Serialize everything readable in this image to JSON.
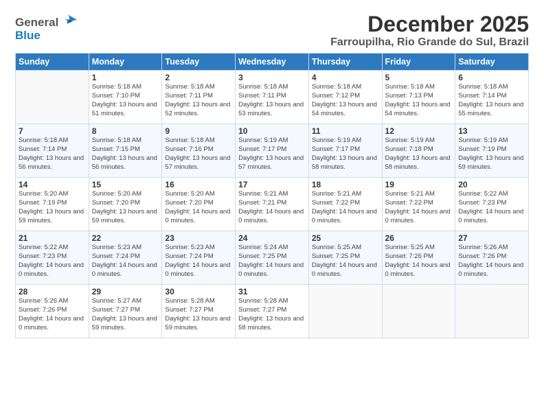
{
  "logo": {
    "general": "General",
    "blue": "Blue"
  },
  "title": {
    "month_year": "December 2025",
    "location": "Farroupilha, Rio Grande do Sul, Brazil"
  },
  "days_of_week": [
    "Sunday",
    "Monday",
    "Tuesday",
    "Wednesday",
    "Thursday",
    "Friday",
    "Saturday"
  ],
  "weeks": [
    [
      {
        "day": "",
        "sunrise": "",
        "sunset": "",
        "daylight": ""
      },
      {
        "day": "1",
        "sunrise": "Sunrise: 5:18 AM",
        "sunset": "Sunset: 7:10 PM",
        "daylight": "Daylight: 13 hours and 51 minutes."
      },
      {
        "day": "2",
        "sunrise": "Sunrise: 5:18 AM",
        "sunset": "Sunset: 7:11 PM",
        "daylight": "Daylight: 13 hours and 52 minutes."
      },
      {
        "day": "3",
        "sunrise": "Sunrise: 5:18 AM",
        "sunset": "Sunset: 7:11 PM",
        "daylight": "Daylight: 13 hours and 53 minutes."
      },
      {
        "day": "4",
        "sunrise": "Sunrise: 5:18 AM",
        "sunset": "Sunset: 7:12 PM",
        "daylight": "Daylight: 13 hours and 54 minutes."
      },
      {
        "day": "5",
        "sunrise": "Sunrise: 5:18 AM",
        "sunset": "Sunset: 7:13 PM",
        "daylight": "Daylight: 13 hours and 54 minutes."
      },
      {
        "day": "6",
        "sunrise": "Sunrise: 5:18 AM",
        "sunset": "Sunset: 7:14 PM",
        "daylight": "Daylight: 13 hours and 55 minutes."
      }
    ],
    [
      {
        "day": "7",
        "sunrise": "Sunrise: 5:18 AM",
        "sunset": "Sunset: 7:14 PM",
        "daylight": "Daylight: 13 hours and 56 minutes."
      },
      {
        "day": "8",
        "sunrise": "Sunrise: 5:18 AM",
        "sunset": "Sunset: 7:15 PM",
        "daylight": "Daylight: 13 hours and 56 minutes."
      },
      {
        "day": "9",
        "sunrise": "Sunrise: 5:18 AM",
        "sunset": "Sunset: 7:16 PM",
        "daylight": "Daylight: 13 hours and 57 minutes."
      },
      {
        "day": "10",
        "sunrise": "Sunrise: 5:19 AM",
        "sunset": "Sunset: 7:17 PM",
        "daylight": "Daylight: 13 hours and 57 minutes."
      },
      {
        "day": "11",
        "sunrise": "Sunrise: 5:19 AM",
        "sunset": "Sunset: 7:17 PM",
        "daylight": "Daylight: 13 hours and 58 minutes."
      },
      {
        "day": "12",
        "sunrise": "Sunrise: 5:19 AM",
        "sunset": "Sunset: 7:18 PM",
        "daylight": "Daylight: 13 hours and 58 minutes."
      },
      {
        "day": "13",
        "sunrise": "Sunrise: 5:19 AM",
        "sunset": "Sunset: 7:19 PM",
        "daylight": "Daylight: 13 hours and 59 minutes."
      }
    ],
    [
      {
        "day": "14",
        "sunrise": "Sunrise: 5:20 AM",
        "sunset": "Sunset: 7:19 PM",
        "daylight": "Daylight: 13 hours and 59 minutes."
      },
      {
        "day": "15",
        "sunrise": "Sunrise: 5:20 AM",
        "sunset": "Sunset: 7:20 PM",
        "daylight": "Daylight: 13 hours and 59 minutes."
      },
      {
        "day": "16",
        "sunrise": "Sunrise: 5:20 AM",
        "sunset": "Sunset: 7:20 PM",
        "daylight": "Daylight: 14 hours and 0 minutes."
      },
      {
        "day": "17",
        "sunrise": "Sunrise: 5:21 AM",
        "sunset": "Sunset: 7:21 PM",
        "daylight": "Daylight: 14 hours and 0 minutes."
      },
      {
        "day": "18",
        "sunrise": "Sunrise: 5:21 AM",
        "sunset": "Sunset: 7:22 PM",
        "daylight": "Daylight: 14 hours and 0 minutes."
      },
      {
        "day": "19",
        "sunrise": "Sunrise: 5:21 AM",
        "sunset": "Sunset: 7:22 PM",
        "daylight": "Daylight: 14 hours and 0 minutes."
      },
      {
        "day": "20",
        "sunrise": "Sunrise: 5:22 AM",
        "sunset": "Sunset: 7:23 PM",
        "daylight": "Daylight: 14 hours and 0 minutes."
      }
    ],
    [
      {
        "day": "21",
        "sunrise": "Sunrise: 5:22 AM",
        "sunset": "Sunset: 7:23 PM",
        "daylight": "Daylight: 14 hours and 0 minutes."
      },
      {
        "day": "22",
        "sunrise": "Sunrise: 5:23 AM",
        "sunset": "Sunset: 7:24 PM",
        "daylight": "Daylight: 14 hours and 0 minutes."
      },
      {
        "day": "23",
        "sunrise": "Sunrise: 5:23 AM",
        "sunset": "Sunset: 7:24 PM",
        "daylight": "Daylight: 14 hours and 0 minutes."
      },
      {
        "day": "24",
        "sunrise": "Sunrise: 5:24 AM",
        "sunset": "Sunset: 7:25 PM",
        "daylight": "Daylight: 14 hours and 0 minutes."
      },
      {
        "day": "25",
        "sunrise": "Sunrise: 5:25 AM",
        "sunset": "Sunset: 7:25 PM",
        "daylight": "Daylight: 14 hours and 0 minutes."
      },
      {
        "day": "26",
        "sunrise": "Sunrise: 5:25 AM",
        "sunset": "Sunset: 7:26 PM",
        "daylight": "Daylight: 14 hours and 0 minutes."
      },
      {
        "day": "27",
        "sunrise": "Sunrise: 5:26 AM",
        "sunset": "Sunset: 7:26 PM",
        "daylight": "Daylight: 14 hours and 0 minutes."
      }
    ],
    [
      {
        "day": "28",
        "sunrise": "Sunrise: 5:26 AM",
        "sunset": "Sunset: 7:26 PM",
        "daylight": "Daylight: 14 hours and 0 minutes."
      },
      {
        "day": "29",
        "sunrise": "Sunrise: 5:27 AM",
        "sunset": "Sunset: 7:27 PM",
        "daylight": "Daylight: 13 hours and 59 minutes."
      },
      {
        "day": "30",
        "sunrise": "Sunrise: 5:28 AM",
        "sunset": "Sunset: 7:27 PM",
        "daylight": "Daylight: 13 hours and 59 minutes."
      },
      {
        "day": "31",
        "sunrise": "Sunrise: 5:28 AM",
        "sunset": "Sunset: 7:27 PM",
        "daylight": "Daylight: 13 hours and 58 minutes."
      },
      {
        "day": "",
        "sunrise": "",
        "sunset": "",
        "daylight": ""
      },
      {
        "day": "",
        "sunrise": "",
        "sunset": "",
        "daylight": ""
      },
      {
        "day": "",
        "sunrise": "",
        "sunset": "",
        "daylight": ""
      }
    ]
  ]
}
